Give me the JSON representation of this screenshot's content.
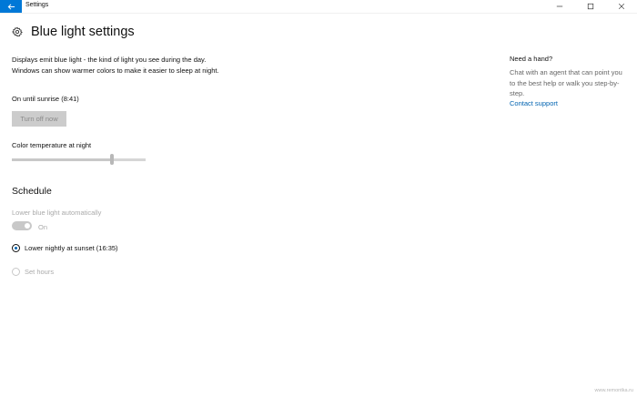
{
  "window": {
    "title": "Settings",
    "back_icon": "arrow-left-icon",
    "accent": "#0078d7"
  },
  "header": {
    "icon": "gear-icon",
    "title": "Blue light settings"
  },
  "main": {
    "description": "Displays emit blue light - the kind of light you see during the day. Windows can show warmer colors to make it easier to sleep at night.",
    "status": "On until sunrise (8:41)",
    "turn_off_button": "Turn off now",
    "color_temp_label": "Color temperature at night",
    "color_temp_value": 0.75
  },
  "schedule": {
    "heading": "Schedule",
    "auto_label": "Lower blue light automatically",
    "toggle_state": "On",
    "toggle_on": true,
    "options": [
      {
        "label": "Lower nightly at sunset (16:35)",
        "selected": true
      },
      {
        "label": "Set hours",
        "selected": false
      }
    ]
  },
  "help": {
    "title": "Need a hand?",
    "text": "Chat with an agent that can point you to the best help or walk you step-by-step.",
    "link": "Contact support"
  },
  "watermark": "www.remontka.ru",
  "colors": {
    "link": "#0063b1",
    "disabled_text": "#aaaaaa",
    "button_bg": "#cccccc"
  }
}
